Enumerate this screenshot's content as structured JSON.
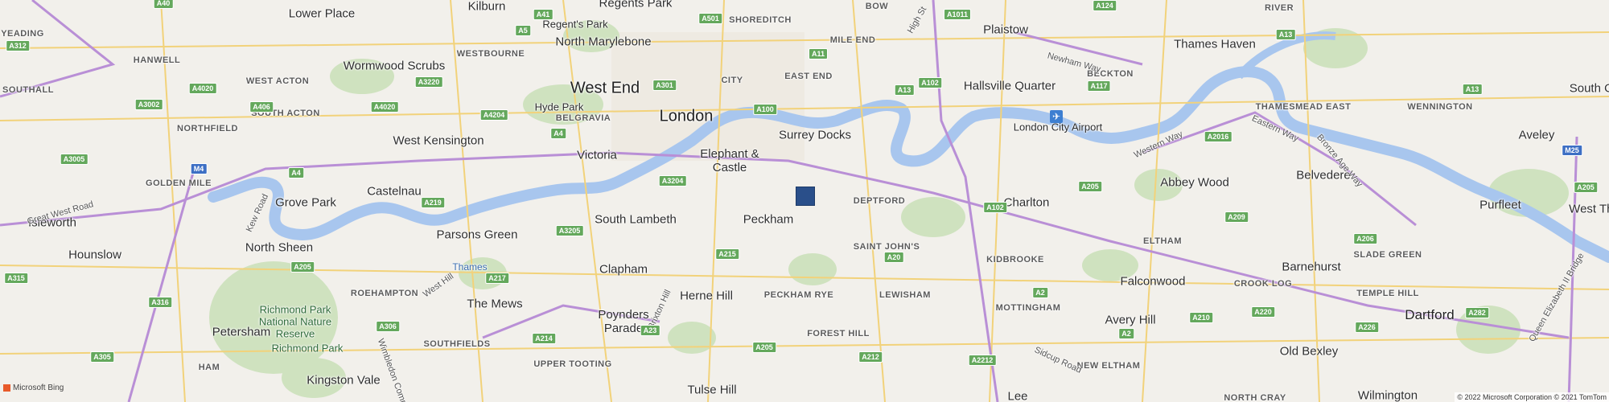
{
  "places": {
    "kilburn": "Kilburn",
    "regents_park": "Regents Park",
    "shoreditch": "SHOREDITCH",
    "bow": "BOW",
    "plaistow": "Plaistow",
    "river": "RIVER",
    "lower_place": "Lower Place",
    "regents_park_small": "Regent's Park",
    "north_marylebone": "North Marylebone",
    "mile_end": "MILE END",
    "thames_haven": "Thames Haven",
    "westbourne": "WESTBOURNE",
    "wormwood_scrubs": "Wormwood Scrubs",
    "hanwell": "HANWELL",
    "west_end": "West End",
    "city": "CITY",
    "east_end": "EAST END",
    "hallsville_quarter": "Hallsville Quarter",
    "beckton": "BECKTON",
    "west_acton": "WEST ACTON",
    "southall": "SOUTHALL",
    "hyde_park": "Hyde Park",
    "london": "London",
    "london_city_airport": "London City Airport",
    "south_acton": "SOUTH ACTON",
    "belgravia": "BELGRAVIA",
    "thamesmead_east": "THAMESMEAD EAST",
    "wennington": "WENNINGTON",
    "northfield": "NORTHFIELD",
    "west_kensington": "West Kensington",
    "surrey_docks": "Surrey Docks",
    "aveley": "Aveley",
    "victoria": "Victoria",
    "elephant_castle": "Elephant & Castle",
    "golden_mile": "GOLDEN MILE",
    "castelnau": "Castelnau",
    "abbey_wood": "Abbey Wood",
    "belvedere": "Belvedere",
    "purfleet": "Purfleet",
    "deptford": "DEPTFORD",
    "charlton": "Charlton",
    "grove_park": "Grove Park",
    "isleworth": "Isleworth",
    "south_lambeth": "South Lambeth",
    "peckham": "Peckham",
    "west_thu": "West Thu",
    "south_oc": "South Oc",
    "saint_johns": "SAINT JOHN'S",
    "north_sheen": "North Sheen",
    "parsons_green": "Parsons Green",
    "eltham": "ELTHAM",
    "slade_green": "SLADE GREEN",
    "hounslow": "Hounslow",
    "thames": "Thames",
    "clapham": "Clapham",
    "kidbrooke": "KIDBROOKE",
    "falconwood": "Falconwood",
    "crook_log": "CROOK LOG",
    "barnehurst": "Barnehurst",
    "roehampton": "ROEHAMPTON",
    "the_mews": "The Mews",
    "herne_hill": "Herne Hill",
    "peckham_rye": "PECKHAM RYE",
    "lewisham": "LEWISHAM",
    "mottingham": "MOTTINGHAM",
    "temple_hill": "TEMPLE HILL",
    "richmond_park_reserve": "Richmond Park National Nature Reserve",
    "poynders_parade": "Poynders Parade",
    "avery_hill": "Avery Hill",
    "dartford": "Dartford",
    "petersham": "Petersham",
    "southfields": "SOUTHFIELDS",
    "richmond_park": "Richmond Park",
    "forest_hill": "FOREST HILL",
    "old_bexley": "Old Bexley",
    "ham": "HAM",
    "upper_tooting": "UPPER TOOTING",
    "new_eltham": "NEW ELTHAM",
    "kingston_vale": "Kingston Vale",
    "tulse_hill": "Tulse Hill",
    "lee": "Lee",
    "north_cray": "NORTH CRAY",
    "wilmington": "Wilmington",
    "yeading": "YEADING"
  },
  "roads": {
    "great_west_road": "Great West Road",
    "kew_road": "Kew Road",
    "west_hill": "West Hill",
    "brixton_hill": "Brixton Hill",
    "western_way": "Western Way",
    "eastern_way": "Eastern Way",
    "bronze_age_way": "Bronze Age Way",
    "newham_way": "Newham Way",
    "sidcup_road": "Sidcup Road",
    "high_st": "High St",
    "queen_elizabeth_bridge": "Queen Elizabeth II Bridge",
    "wimbledon_common": "Wimbledon Common"
  },
  "shields": [
    "A40",
    "A5",
    "A41",
    "A501",
    "A1011",
    "A124",
    "A13",
    "A312",
    "A4020",
    "A3220",
    "A11",
    "A117",
    "A406",
    "A4020",
    "A301",
    "A13",
    "A102",
    "A3002",
    "A4204",
    "A100",
    "A4",
    "A2016",
    "A13",
    "A3005",
    "M4",
    "A3204",
    "A205",
    "A4",
    "A219",
    "A102",
    "A209",
    "M25",
    "A3205",
    "A215",
    "A20",
    "A205",
    "A206",
    "A205",
    "A217",
    "A2",
    "A210",
    "A315",
    "A316",
    "A306",
    "A214",
    "A23",
    "A205",
    "A212",
    "A2212",
    "A220",
    "A226",
    "A282",
    "A305",
    "A2"
  ],
  "marker": {
    "icon": "square-pin",
    "color": "#2a4f8a"
  },
  "attribution": {
    "logo_text": "Microsoft Bing",
    "copyright": "© 2022 Microsoft Corporation © 2021 TomTom"
  },
  "colors": {
    "water": "#a8c6ee",
    "park": "#cfe2bf",
    "major_road": "#b98fd6",
    "minor_road": "#f2d27a"
  }
}
